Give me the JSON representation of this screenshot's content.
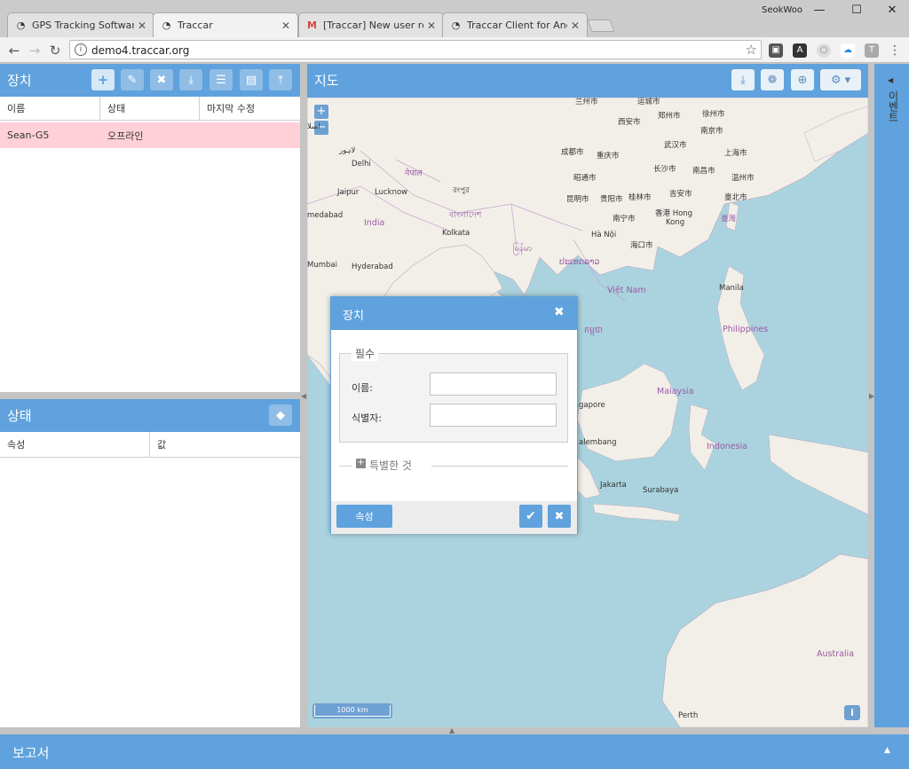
{
  "browser": {
    "user_name": "SeokWoo",
    "tabs": [
      {
        "label": "GPS Tracking Software -",
        "icon": "traccar-icon"
      },
      {
        "label": "Traccar",
        "icon": "traccar-icon"
      },
      {
        "label": "[Traccar] New user regi",
        "icon": "gmail-icon"
      },
      {
        "label": "Traccar Client for Andro",
        "icon": "traccar-icon"
      }
    ],
    "address": "demo4.traccar.org"
  },
  "devices_panel": {
    "title": "장치",
    "columns": [
      "이름",
      "상태",
      "마지막 수정"
    ],
    "rows": [
      {
        "name": "Sean-G5",
        "status": "오프라인",
        "last_update": ""
      }
    ],
    "selected_color": "#ffd0d8"
  },
  "state_panel": {
    "title": "상태",
    "columns": [
      "속성",
      "값"
    ]
  },
  "map_panel": {
    "title": "지도",
    "scale": "1000 km",
    "labels": {
      "lanzhou": "兰州市",
      "xian": "西安市",
      "zhengzhou": "郑州市",
      "xuzhou": "徐州市",
      "yuncheng": "运城市",
      "nanjing": "南京市",
      "wuhan": "武汉市",
      "shanghai": "上海市",
      "chengdu": "成都市",
      "chongqing": "重庆市",
      "changsha": "长沙市",
      "nanchang": "南昌市",
      "wenzhou": "温州市",
      "zhaotong": "昭通市",
      "kunming": "昆明市",
      "guiyang": "贵阳市",
      "guilin": "桂林市",
      "jian": "吉安市",
      "taipei": "臺北市",
      "taiwan": "臺灣",
      "nanning": "南宁市",
      "hongkong1": "香港 Hong",
      "hongkong2": "Kong",
      "hanoi": "Hà Nội",
      "haikou": "海口市",
      "delhi": "Delhi",
      "nepal": "नेपाल",
      "lahore": "لاہور",
      "jaipur": "Jaipur",
      "lucknow": "Lucknow",
      "ahmedabad": "medabad",
      "india": "India",
      "kolkata": "Kolkata",
      "bangladesh": "বাংলাদেশ",
      "rangpur": "রংপুর",
      "mumbai": "Mumbai",
      "hyderabad": "Hyderabad",
      "myanmar": "မြန်မာ",
      "laos": "ປະເທດລາວ",
      "vietnam": "Việt Nam",
      "manila": "Manila",
      "philippines": "Philippines",
      "cambodia": "កម្ពុជា",
      "malaysia": "Malaysia",
      "singapore": "gapore",
      "indonesia": "Indonesia",
      "palembang": "alembang",
      "jakarta": "Jakarta",
      "surabaya": "Surabaya",
      "australia": "Australia",
      "perth": "Perth",
      "islamabad": "اسلا"
    }
  },
  "dialog": {
    "title": "장치",
    "required_legend": "필수",
    "name_label": "이름:",
    "identifier_label": "식별자:",
    "name_value": "",
    "identifier_value": "",
    "extra_legend": "특별한 것",
    "attributes_button": "속성"
  },
  "events_panel": {
    "title": "이벤트"
  },
  "reports_panel": {
    "title": "보고서"
  },
  "colors": {
    "accent": "#5fa2dd",
    "water": "#aad3df",
    "land": "#f2efe9"
  }
}
